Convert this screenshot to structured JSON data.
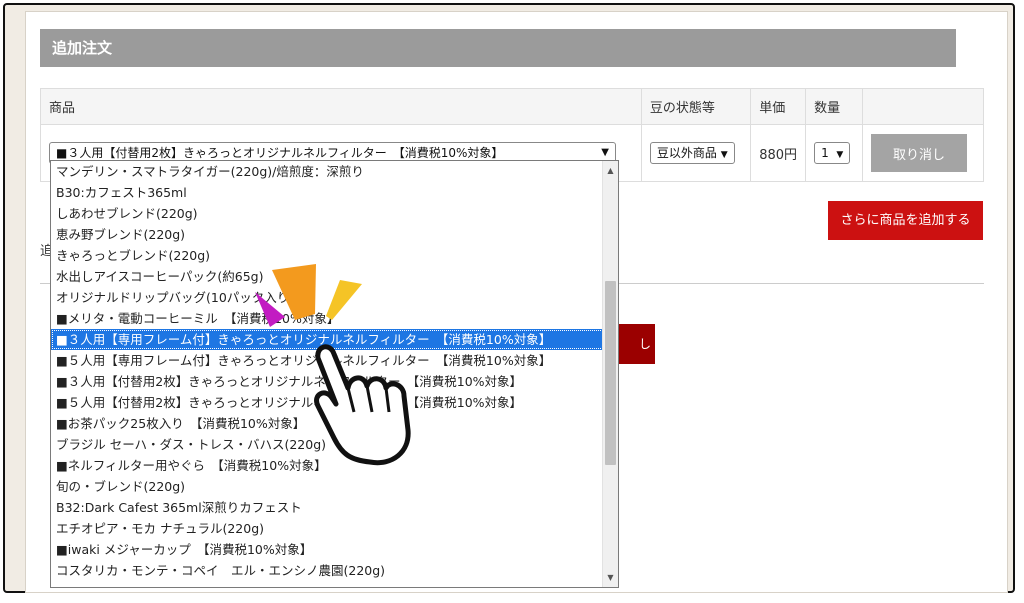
{
  "header": {
    "title": "追加注文"
  },
  "table": {
    "columns": [
      "商品",
      "豆の状態等",
      "単価",
      "数量"
    ],
    "row": {
      "product_value": "■３人用【付替用2枚】きゃろっとオリジナルネルフィルター　【消費税10%対象】",
      "bean_state": "豆以外商品",
      "unit_price": "880円",
      "quantity": "1",
      "cancel_label": "取り消し"
    }
  },
  "add_more_label": "さらに商品を追加する",
  "left_clipped_text": "追",
  "red_button_clip": "し",
  "dropdown": {
    "items": [
      "マンデリン・スマトラタイガー(220g)/焙煎度：深煎り",
      "B30:カフェスト365ml",
      "しあわせブレンド(220g)",
      "恵み野ブレンド(220g)",
      "きゃろっとブレンド(220g)",
      "水出しアイスコーヒーパック(約65g)",
      "オリジナルドリップバッグ(10パック入り)",
      "■メリタ・電動コーヒーミル　【消費税10%対象】",
      "■３人用【専用フレーム付】きゃろっとオリジナルネルフィルター　【消費税10%対象】",
      "■５人用【専用フレーム付】きゃろっとオリジナルネルフィルター　【消費税10%対象】",
      "■３人用【付替用2枚】きゃろっとオリジナルネルフィルター　【消費税10%対象】",
      "■５人用【付替用2枚】きゃろっとオリジナルネルフィルター　【消費税10%対象】",
      "■お茶パック25枚入り　【消費税10%対象】",
      "ブラジル セーハ・ダス・トレス・バハス(220g)",
      "■ネルフィルター用やぐら　【消費税10%対象】",
      "旬の・ブレンド(220g)",
      "B32:Dark Cafest 365ml深煎りカフェスト",
      "エチオピア・モカ ナチュラル(220g)",
      "■iwaki メジャーカップ　【消費税10%対象】",
      "コスタリカ・モンテ・コペイ　エル・エンシノ農園(220g)"
    ],
    "selected_index": 8
  },
  "colors": {
    "accent_red": "#cc1111",
    "selected_blue": "#1e76e3",
    "header_gray": "#9b9b9b"
  }
}
